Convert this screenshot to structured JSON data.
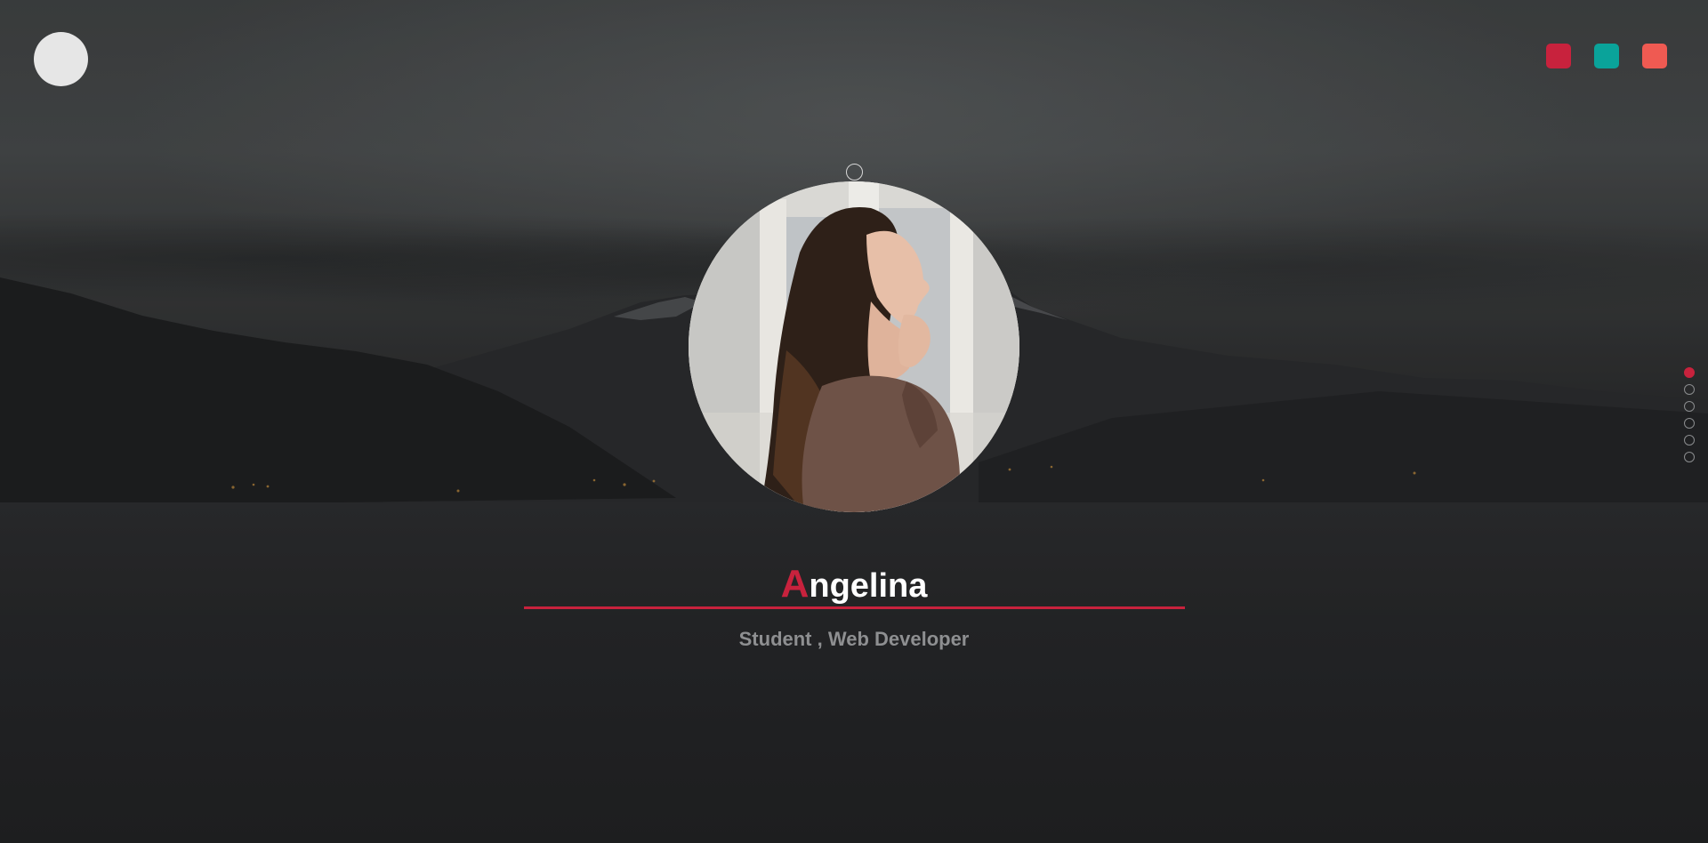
{
  "header": {
    "logo_icon": "avatar-circle",
    "theme_swatches": [
      {
        "name": "crimson",
        "color": "#c8223d"
      },
      {
        "name": "teal",
        "color": "#0aa39a"
      },
      {
        "name": "coral",
        "color": "#ef5a52"
      }
    ]
  },
  "profile": {
    "name_initial": "A",
    "name_rest": "ngelina",
    "subtitle": "Student , Web Developer",
    "accent_color": "#c8223d"
  },
  "side_nav": {
    "total": 6,
    "active_index": 0
  }
}
